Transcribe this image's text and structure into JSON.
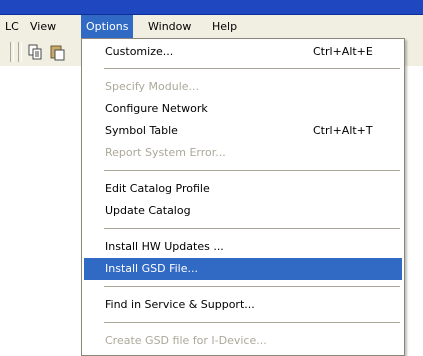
{
  "menubar": {
    "items": [
      {
        "label": "LC"
      },
      {
        "label": "View"
      },
      {
        "label": "Options"
      },
      {
        "label": "Window"
      },
      {
        "label": "Help"
      }
    ]
  },
  "toolbar": {
    "buttons": [
      {
        "icon": "copy-icon"
      },
      {
        "icon": "paste-icon"
      }
    ]
  },
  "options_menu": {
    "items": [
      {
        "label": "Customize...",
        "shortcut": "Ctrl+Alt+E",
        "enabled": true
      },
      {
        "label": "Specify Module...",
        "enabled": false
      },
      {
        "label": "Configure Network",
        "enabled": true
      },
      {
        "label": "Symbol Table",
        "shortcut": "Ctrl+Alt+T",
        "enabled": true
      },
      {
        "label": "Report System Error...",
        "enabled": false
      },
      {
        "label": "Edit Catalog Profile",
        "enabled": true
      },
      {
        "label": "Update Catalog",
        "enabled": true
      },
      {
        "label": "Install HW Updates ...",
        "enabled": true
      },
      {
        "label": "Install GSD File...",
        "enabled": true,
        "highlighted": true
      },
      {
        "label": "Find in Service & Support...",
        "enabled": true
      },
      {
        "label": "Create GSD file for I-Device...",
        "enabled": false
      }
    ]
  },
  "colors": {
    "highlight": "#316ac5",
    "menubar_bg": "#f1efe2",
    "disabled_text": "#aca899",
    "titlebar": "#1f48c0"
  }
}
